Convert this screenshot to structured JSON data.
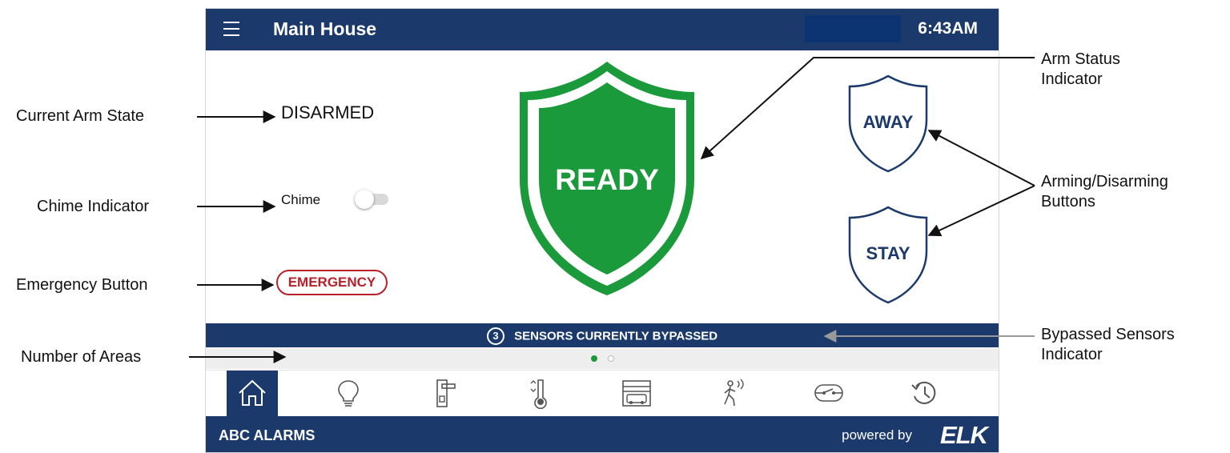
{
  "header": {
    "title": "Main House",
    "time": "6:43AM"
  },
  "arm_state": "DISARMED",
  "chime": {
    "label": "Chime",
    "enabled": false
  },
  "emergency_label": "EMERGENCY",
  "status_shield": {
    "label": "READY",
    "color": "#1a9a3a"
  },
  "arm_buttons": {
    "away": "AWAY",
    "stay": "STAY"
  },
  "bypass": {
    "count": "3",
    "text": "SENSORS CURRENTLY BYPASSED"
  },
  "area_pages": {
    "total": 2,
    "active": 1
  },
  "nav": [
    {
      "name": "nav-home",
      "icon": "home-icon",
      "active": true
    },
    {
      "name": "nav-lighting",
      "icon": "light-bulb-icon",
      "active": false
    },
    {
      "name": "nav-locks",
      "icon": "door-lock-icon",
      "active": false
    },
    {
      "name": "nav-thermostat",
      "icon": "thermometer-icon",
      "active": false
    },
    {
      "name": "nav-garage",
      "icon": "garage-icon",
      "active": false
    },
    {
      "name": "nav-sensors",
      "icon": "motion-sensor-icon",
      "active": false
    },
    {
      "name": "nav-outputs",
      "icon": "switch-icon",
      "active": false
    },
    {
      "name": "nav-history",
      "icon": "history-icon",
      "active": false
    }
  ],
  "footer": {
    "brand": "ABC ALARMS",
    "powered_by": "powered by",
    "logo": "ELK"
  },
  "callouts": {
    "current_arm_state": "Current Arm State",
    "chime_indicator": "Chime Indicator",
    "emergency_button": "Emergency Button",
    "number_of_areas": "Number of Areas",
    "arm_status_line1": "Arm Status",
    "arm_status_line2": "Indicator",
    "arming_line1": "Arming/Disarming",
    "arming_line2": "Buttons",
    "bypassed_line1": "Bypassed Sensors",
    "bypassed_line2": "Indicator"
  },
  "colors": {
    "primary": "#1b3a6b",
    "ready_green": "#1a9a3a",
    "emergency_red": "#b8202a",
    "shield_outline": "#1b3a6b"
  }
}
